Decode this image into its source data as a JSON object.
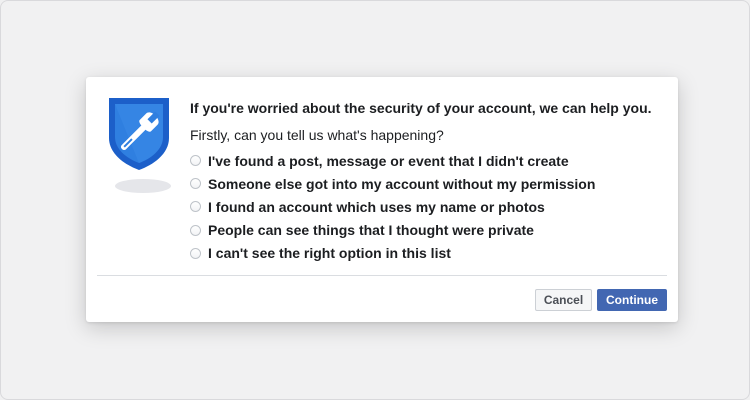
{
  "dialog": {
    "title": "If you're worried about the security of your account, we can help you.",
    "subtitle": "Firstly, can you tell us what's happening?",
    "options": [
      {
        "label": "I've found a post, message or event that I didn't create",
        "selected": false
      },
      {
        "label": "Someone else got into my account without my permission",
        "selected": false
      },
      {
        "label": "I found an account which uses my name or photos",
        "selected": false
      },
      {
        "label": "People can see things that I thought were private",
        "selected": false
      },
      {
        "label": "I can't see the right option in this list",
        "selected": false
      }
    ],
    "cancel_label": "Cancel",
    "continue_label": "Continue"
  },
  "illustration": {
    "icon": "shield-wrench-icon",
    "colors": {
      "shield_outer": "#1877f2",
      "shield_inner": "#2d7bd8",
      "wrench": "#ffffff"
    }
  },
  "colors": {
    "accent": "#4267b2",
    "background": "#f0f0f1",
    "card": "#ffffff"
  }
}
